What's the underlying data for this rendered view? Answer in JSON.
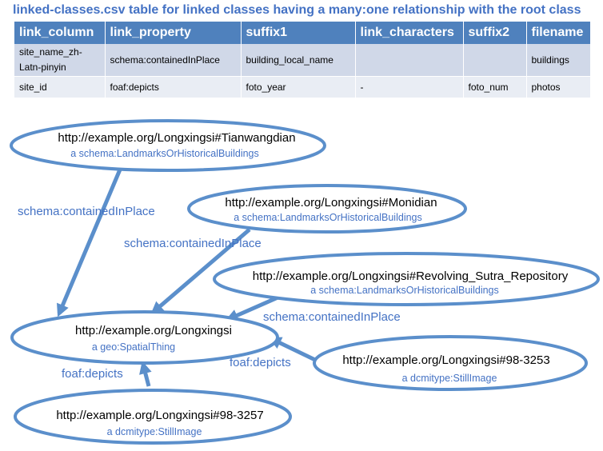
{
  "title": "linked-classes.csv table for linked classes having a many:one relationship with the root class",
  "table": {
    "headers": [
      "link_column",
      "link_property",
      "suffix1",
      "link_characters",
      "suffix2",
      "filename"
    ],
    "rows": [
      [
        "site_name_zh-Latn-pinyin",
        "schema:containedInPlace",
        "building_local_name",
        "",
        "",
        "buildings"
      ],
      [
        "site_id",
        "foaf:depicts",
        "foto_year",
        "-",
        "foto_num",
        "photos"
      ]
    ]
  },
  "diagram": {
    "colors": {
      "accent": "#4472c4",
      "stroke": "#5b8fcb"
    },
    "nodes": [
      {
        "id": "tianwangdian",
        "uri": "http://example.org/Longxingsi#Tianwangdian",
        "class": "a schema:LandmarksOrHistoricalBuildings"
      },
      {
        "id": "monidian",
        "uri": "http://example.org/Longxingsi#Monidian",
        "class": "a schema:LandmarksOrHistoricalBuildings"
      },
      {
        "id": "revolving",
        "uri": "http://example.org/Longxingsi#Revolving_Sutra_Repository",
        "class": "a schema:LandmarksOrHistoricalBuildings"
      },
      {
        "id": "longxingsi",
        "uri": "http://example.org/Longxingsi",
        "class": "a geo:SpatialThing"
      },
      {
        "id": "photo3253",
        "uri": "http://example.org/Longxingsi#98-3253",
        "class": "a dcmitype:StillImage"
      },
      {
        "id": "photo3257",
        "uri": "http://example.org/Longxingsi#98-3257",
        "class": "a dcmitype:StillImage"
      }
    ],
    "edges": [
      {
        "from": "tianwangdian",
        "to": "longxingsi",
        "label": "schema:containedInPlace"
      },
      {
        "from": "monidian",
        "to": "longxingsi",
        "label": "schema:containedInPlace"
      },
      {
        "from": "revolving",
        "to": "longxingsi",
        "label": "schema:containedInPlace"
      },
      {
        "from": "photo3253",
        "to": "longxingsi",
        "label": "foaf:depicts"
      },
      {
        "from": "photo3257",
        "to": "longxingsi",
        "label": "foaf:depicts"
      }
    ]
  }
}
